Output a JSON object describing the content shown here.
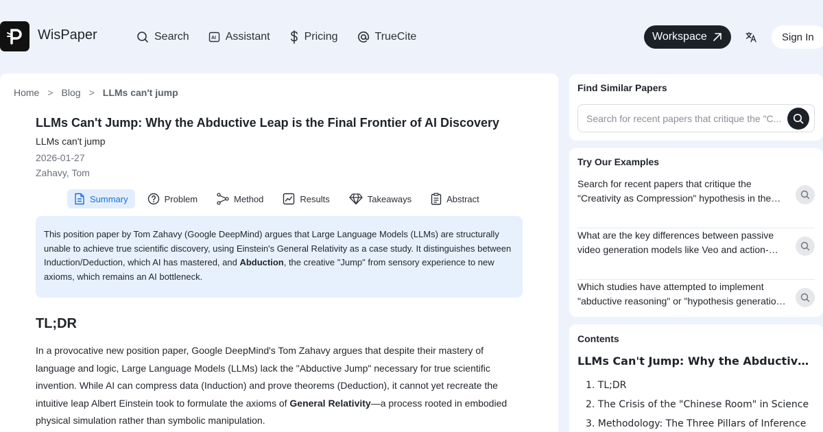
{
  "header": {
    "brand": "WisPaper",
    "nav": [
      {
        "label": "Search",
        "icon": "search-icon"
      },
      {
        "label": "Assistant",
        "icon": "ai-assistant-icon"
      },
      {
        "label": "Pricing",
        "icon": "dollar-icon"
      },
      {
        "label": "TrueCite",
        "icon": "at-icon"
      }
    ],
    "workspace_label": "Workspace",
    "signin_label": "Sign In"
  },
  "breadcrumb": {
    "home": "Home",
    "blog": "Blog",
    "current": "LLMs can't jump",
    "separator": ">"
  },
  "article": {
    "title": "LLMs Can't Jump: Why the Abductive Leap is the Final Frontier of AI Discovery",
    "subtitle": "LLMs can't jump",
    "date": "2026-01-27",
    "author": "Zahavy, Tom",
    "tabs": [
      {
        "label": "Summary",
        "icon": "document-icon",
        "active": true
      },
      {
        "label": "Problem",
        "icon": "question-icon",
        "active": false
      },
      {
        "label": "Method",
        "icon": "method-icon",
        "active": false
      },
      {
        "label": "Results",
        "icon": "chart-line-icon",
        "active": false
      },
      {
        "label": "Takeaways",
        "icon": "diamond-icon",
        "active": false
      },
      {
        "label": "Abstract",
        "icon": "clipboard-icon",
        "active": false
      }
    ],
    "summary_part1": "This position paper by Tom Zahavy (Google DeepMind) argues that Large Language Models (LLMs) are structurally unable to achieve true scientific discovery, using Einstein's General Relativity as a case study. It distinguishes between Induction/Deduction, which AI has mastered, and ",
    "summary_bold": "Abduction",
    "summary_part2": ", the creative \"Jump\" from sensory experience to new axioms, which remains an AI bottleneck.",
    "tldr_heading": "TL;DR",
    "body_part1": "In a provocative new position paper, Google DeepMind's Tom Zahavy argues that despite their mastery of language and logic, Large Language Models (LLMs) lack the \"Abductive Jump\" necessary for true scientific invention. While AI can compress data (Induction) and prove theorems (Deduction), it cannot yet recreate the intuitive leap Albert Einstein took to formulate the axioms of ",
    "body_bold": "General Relativity",
    "body_part2": "—a process rooted in embodied physical simulation rather than symbolic manipulation."
  },
  "sidebar": {
    "find_title": "Find Similar Papers",
    "search_placeholder": "Search for recent papers that critique the \"C...",
    "examples_title": "Try Our Examples",
    "examples": [
      "Search for recent papers that critique the \"Creativity as Compression\" hypothesis in the…",
      "What are the key differences between passive video generation models like Veo and action-…",
      "Which studies have attempted to implement \"abductive reasoning\" or \"hypothesis generatio…"
    ],
    "contents_title": "Contents",
    "contents_heading": "LLMs Can't Jump: Why the Abductive Leap is the Final Frontier of AI Discovery",
    "contents_items": [
      "1. TL;DR",
      "2. The Crisis of the \"Chinese Room\" in Science",
      "3. Methodology: The Three Pillars of Inference"
    ]
  },
  "colors": {
    "accent": "#1a6fd6",
    "dark": "#1c2128",
    "page_bg": "#eef3fb",
    "summary_bg": "#e7f1fd"
  }
}
